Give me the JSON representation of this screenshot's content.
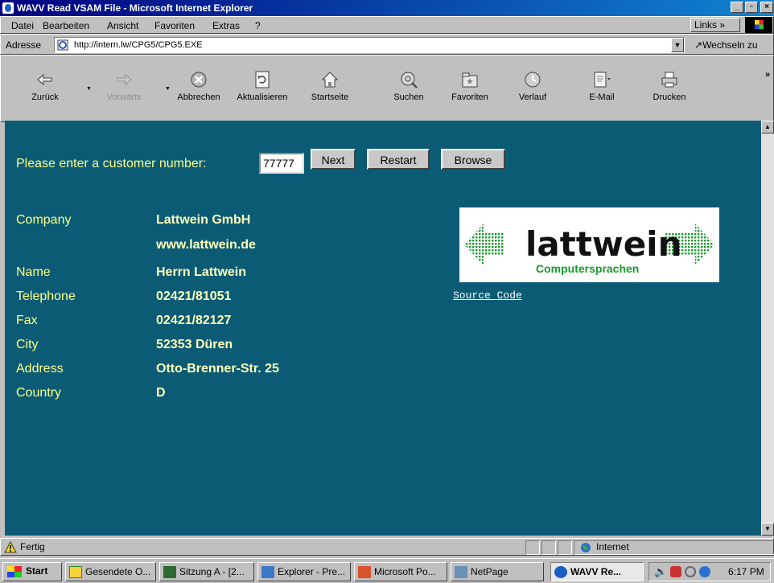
{
  "window": {
    "title": "WAVV Read VSAM File - Microsoft Internet Explorer",
    "minimize": "_",
    "maximize": "▫",
    "close": "×"
  },
  "menu": [
    "Datei",
    "Bearbeiten",
    "Ansicht",
    "Favoriten",
    "Extras",
    "?"
  ],
  "links_label": "Links »",
  "address": {
    "label": "Adresse",
    "url": "http://intern.lw/CPG5/CPG5.EXE",
    "go_label": "Wechseln zu"
  },
  "toolbar": [
    "Zurück",
    "Vorwärts",
    "Abbrechen",
    "Aktualisieren",
    "Startseite",
    "Suchen",
    "Favoriten",
    "Verlauf",
    "E-Mail",
    "Drucken"
  ],
  "toolbar_more": "»",
  "form": {
    "prompt": "Please enter a customer number:",
    "customer_number": "77777",
    "next_label": "Next",
    "restart_label": "Restart",
    "browse_label": "Browse"
  },
  "record": {
    "company_label": "Company",
    "company_value": "Lattwein GmbH",
    "website": "www.lattwein.de",
    "name_label": "Name",
    "name_value": "Herrn Lattwein",
    "telephone_label": "Telephone",
    "telephone_value": "02421/81051",
    "fax_label": "Fax",
    "fax_value": "02421/82127",
    "city_label": "City",
    "city_value": "52353 Düren",
    "address_label": "Address",
    "address_value": "Otto-Brenner-Str. 25",
    "country_label": "Country",
    "country_value": "D"
  },
  "logo": {
    "wordmark": "lattwein",
    "tagline": "Computersprachen"
  },
  "source_code_link": "Source Code",
  "status": {
    "text": "Fertig",
    "zone": "Internet"
  },
  "taskbar": {
    "start_label": "Start",
    "tasks": [
      "Gesendete O...",
      "Sitzung A - [2...",
      "Explorer - Pre...",
      "Microsoft Po...",
      "NetPage",
      "WAVV Re..."
    ],
    "clock": "6:17 PM"
  },
  "colors": {
    "content_bg": "#0b5b75",
    "label_text": "#ffff85",
    "value_text": "#ffffbb",
    "logo_green": "#1a9a2c",
    "titlebar": "#000080"
  }
}
